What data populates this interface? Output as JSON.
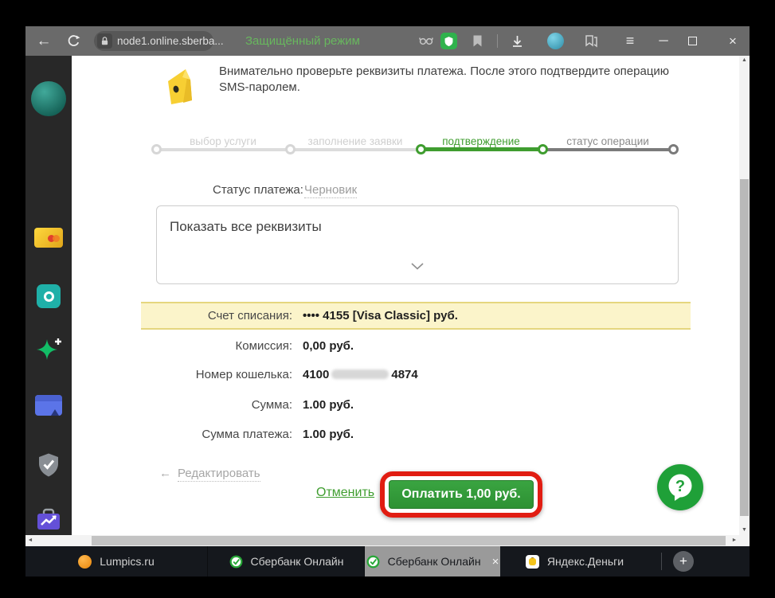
{
  "browser": {
    "url": "node1.online.sberba...",
    "secure_mode": "Защищённый режим"
  },
  "glyphs": {
    "back": "←",
    "menu": "≡",
    "minimize": "─",
    "close": "×",
    "tab_close": "×",
    "new_tab": "+",
    "scroll_up": "▲",
    "scroll_down": "▼",
    "scroll_left": "◄",
    "scroll_right": "►",
    "edit_arrow": "←"
  },
  "sidebar": {
    "icons": [
      "profile-avatar",
      "bank-card",
      "messenger",
      "sparkle-plus",
      "wallet",
      "shield-check",
      "briefcase-chart"
    ]
  },
  "page": {
    "notice": "Внимательно проверьте реквизиты платежа. После этого подтвердите операцию SMS-паролем.",
    "steps": [
      {
        "label": "выбор услуги",
        "state": "past"
      },
      {
        "label": "заполнение заявки",
        "state": "past"
      },
      {
        "label": "подтверждение",
        "state": "current"
      },
      {
        "label": "статус операции",
        "state": "future"
      }
    ],
    "status_label": "Статус платежа:",
    "status_value": "Черновик",
    "requisites_toggle": "Показать все реквизиты",
    "details": {
      "debit_label": "Счет списания:",
      "debit_value": "•••• 4155  [Visa Classic]  руб.",
      "fee_label": "Комиссия:",
      "fee_value": "0,00 руб.",
      "wallet_label": "Номер кошелька:",
      "wallet_prefix": "4100",
      "wallet_suffix": "4874",
      "amount_label": "Сумма:",
      "amount_value": "1.00 руб.",
      "total_label": "Сумма платежа:",
      "total_value": "1.00 руб."
    },
    "edit_link": "Редактировать",
    "cancel_link": "Отменить",
    "pay_button": "Оплатить 1,00 руб."
  },
  "tabs": {
    "items": [
      {
        "title": "Lumpics.ru"
      },
      {
        "title": "Сбербанк Онлайн"
      },
      {
        "title": "Сбербанк Онлайн"
      },
      {
        "title": "Яндекс.Деньги"
      }
    ]
  },
  "colors": {
    "accent_green": "#3f9d2f",
    "protect_green": "#2fb24c",
    "annotation_red": "#e11d12",
    "highlight_yellow": "#fbf4ca"
  }
}
